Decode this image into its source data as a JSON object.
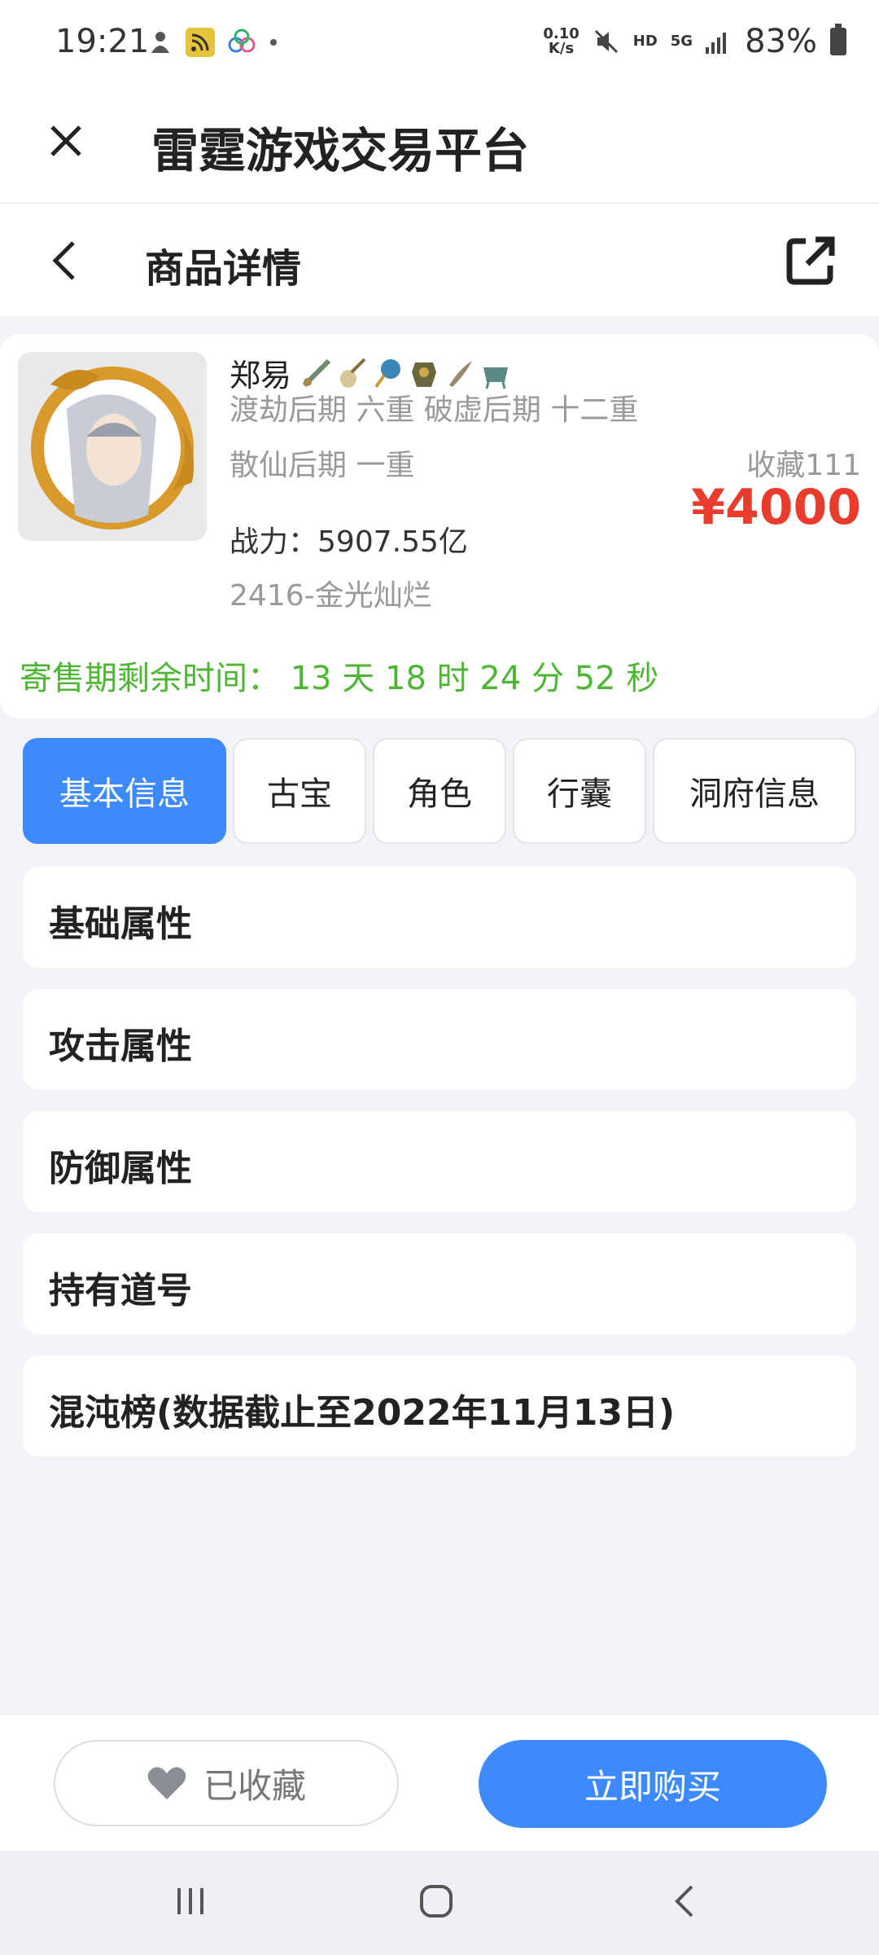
{
  "status": {
    "time": "19:21",
    "speed_top": "0.10",
    "speed_bottom": "K/s",
    "hd": "HD",
    "network": "5G",
    "battery": "83%"
  },
  "header": {
    "app_title": "雷霆游戏交易平台",
    "page_title": "商品详情"
  },
  "product": {
    "name": "郑易",
    "line1": "渡劫后期 六重 破虚后期 十二重",
    "line2": "散仙后期 一重",
    "power_label": "战力：",
    "power_value": "5907.55亿",
    "server": "2416-金光灿烂",
    "favorites": "收藏111",
    "price": "¥4000",
    "countdown_label": "寄售期剩余时间：",
    "countdown_value": "13 天 18 时 24 分 52 秒"
  },
  "tabs": [
    {
      "label": "基本信息",
      "active": true
    },
    {
      "label": "古宝",
      "active": false
    },
    {
      "label": "角色",
      "active": false
    },
    {
      "label": "行囊",
      "active": false
    },
    {
      "label": "洞府信息",
      "active": false
    }
  ],
  "sections": [
    {
      "label": "基础属性"
    },
    {
      "label": "攻击属性"
    },
    {
      "label": "防御属性"
    },
    {
      "label": "持有道号"
    },
    {
      "label": "混沌榜(数据截止至2022年11月13日)"
    }
  ],
  "actions": {
    "favorited_label": "已收藏",
    "buy_label": "立即购买"
  },
  "colors": {
    "accent_blue": "#3d8aff",
    "price_red": "#ea3c2d",
    "countdown_green": "#4db633"
  }
}
